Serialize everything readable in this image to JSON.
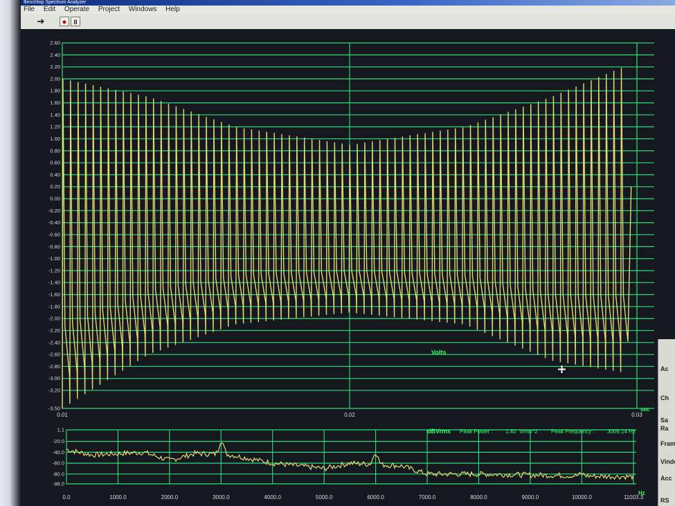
{
  "window": {
    "title": "Benchtop Spectrum Analyzer",
    "menu": [
      "File",
      "Edit",
      "Operate",
      "Project",
      "Windows",
      "Help"
    ]
  },
  "toolbar": {
    "run_icon": "arrow-right-icon",
    "stop_icon": "stop-icon",
    "pause_label": "II"
  },
  "time_plot": {
    "unit_label": "Volts",
    "x_unit": "sec",
    "y_ticks": [
      "2.60",
      "2.40",
      "2.20",
      "2.00",
      "1.80",
      "1.60",
      "1.40",
      "1.20",
      "1.00",
      "0.80",
      "0.60",
      "0.40",
      "0.20",
      "0.00",
      "-0.20",
      "-0.40",
      "-0.60",
      "-0.80",
      "-1.00",
      "-1.20",
      "-1.40",
      "-1.60",
      "-1.80",
      "-2.00",
      "-2.20",
      "-2.40",
      "-2.60",
      "-2.80",
      "-3.00",
      "-3.20",
      "-3.50"
    ],
    "x_ticks": [
      "0.01",
      "0.02",
      "0.03"
    ],
    "colors": {
      "grid": "#2fe07a",
      "trace": "#e4d872",
      "background": "#15181f"
    }
  },
  "spectrum_plot": {
    "unit_label": "dBVrms",
    "peak_power_label": "Peak Power :",
    "peak_power_value": "1.40",
    "peak_power_unit": "Vrms^2",
    "peak_freq_label": "Peak Frequency :",
    "peak_freq_value": "3006.14 Hz",
    "x_unit": "Hz",
    "y_ticks": [
      "1.1",
      "-20.0",
      "-40.0",
      "-60.0",
      "-80.0",
      "-98.0"
    ],
    "x_ticks": [
      "0.0",
      "1000.0",
      "2000.0",
      "3000.0",
      "4000.0",
      "5000.0",
      "6000.0",
      "7000.0",
      "8000.0",
      "9000.0",
      "10000.0",
      "11003.3"
    ]
  },
  "side_panel": {
    "labels": [
      "Ac",
      "Ch",
      "Sa",
      "Ra",
      "Fram",
      "Vinde",
      "Acc",
      "RS"
    ]
  },
  "chart_data": [
    {
      "type": "line",
      "title": "",
      "xlabel": "sec",
      "ylabel": "Volts",
      "xlim": [
        0.01,
        0.03
      ],
      "ylim": [
        -3.5,
        2.6
      ],
      "cycles": 75,
      "envelope_peak": [
        [
          0.01,
          2.0
        ],
        [
          0.013,
          1.7
        ],
        [
          0.016,
          1.2
        ],
        [
          0.02,
          0.9
        ],
        [
          0.024,
          1.2
        ],
        [
          0.027,
          1.7
        ],
        [
          0.0295,
          2.2
        ]
      ],
      "envelope_trough": [
        [
          0.01,
          -3.5
        ],
        [
          0.013,
          -2.6
        ],
        [
          0.016,
          -2.1
        ],
        [
          0.02,
          -1.9
        ],
        [
          0.024,
          -2.1
        ],
        [
          0.027,
          -2.7
        ],
        [
          0.0295,
          -2.9
        ]
      ]
    },
    {
      "type": "line",
      "title": "",
      "xlabel": "Hz",
      "ylabel": "dBVrms",
      "xlim": [
        0,
        11003.3
      ],
      "ylim": [
        -98,
        1.1
      ],
      "peaks": [
        {
          "x": 3006.14,
          "y": -18
        },
        {
          "x": 6000,
          "y": -40
        },
        {
          "x": 9000,
          "y": -82
        },
        {
          "x": 10000,
          "y": -80
        }
      ],
      "baseline": [
        [
          0,
          -35
        ],
        [
          500,
          -45
        ],
        [
          1500,
          -40
        ],
        [
          2000,
          -55
        ],
        [
          2500,
          -42
        ],
        [
          3200,
          -45
        ],
        [
          4000,
          -60
        ],
        [
          5000,
          -70
        ],
        [
          5500,
          -60
        ],
        [
          6500,
          -65
        ],
        [
          7000,
          -80
        ],
        [
          8000,
          -80
        ],
        [
          11003.3,
          -85
        ]
      ]
    }
  ]
}
